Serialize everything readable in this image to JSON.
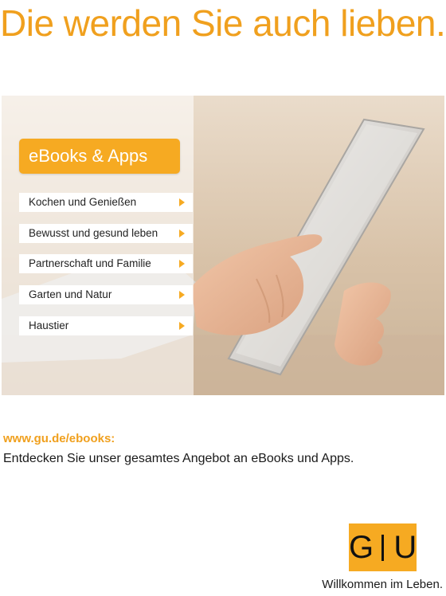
{
  "headline": "Die werden Sie auch lieben.",
  "hero": {
    "badge": "eBooks & Apps",
    "categories": [
      "Kochen und Genießen",
      "Bewusst und gesund leben",
      "Partnerschaft und Familie",
      "Garten und Natur",
      "Haustier"
    ]
  },
  "promo": {
    "link": "www.gu.de/ebooks:",
    "text": "Entdecken Sie unser gesamtes Angebot an eBooks und Apps."
  },
  "brand": {
    "logo_left": "G",
    "logo_right": "U",
    "tagline": "Willkommen im Leben.",
    "accent_color": "#F6AA22",
    "headline_color": "#F0A01E"
  },
  "icons": [
    "arrow-right-icon",
    "tablet-image",
    "hand-image"
  ]
}
